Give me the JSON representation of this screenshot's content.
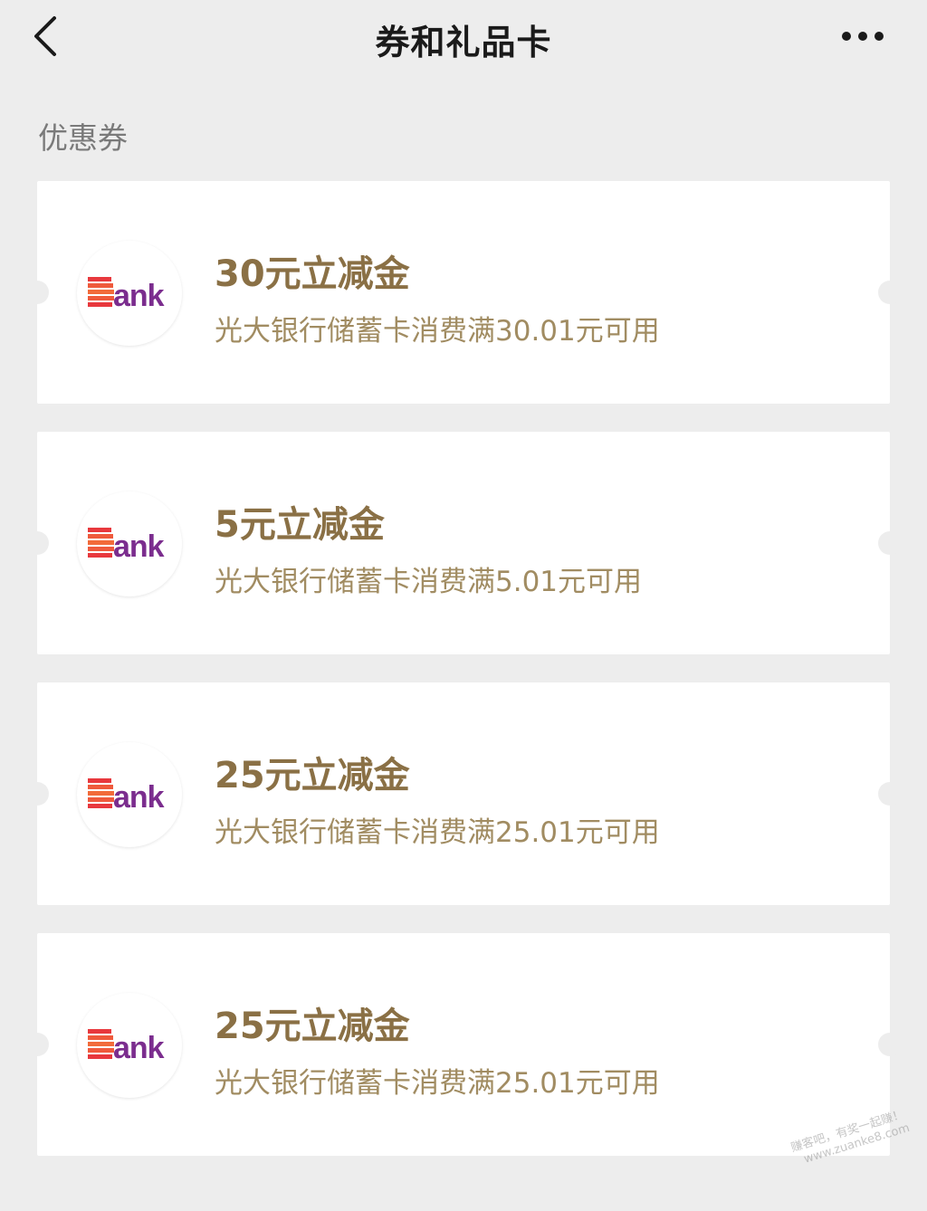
{
  "header": {
    "title": "券和礼品卡"
  },
  "section": {
    "label": "优惠券"
  },
  "coupons": [
    {
      "title": "30元立减金",
      "desc": "光大银行储蓄卡消费满30.01元可用",
      "logo_text": "Bank"
    },
    {
      "title": "5元立减金",
      "desc": "光大银行储蓄卡消费满5.01元可用",
      "logo_text": "Bank"
    },
    {
      "title": "25元立减金",
      "desc": "光大银行储蓄卡消费满25.01元可用",
      "logo_text": "Bank"
    },
    {
      "title": "25元立减金",
      "desc": "光大银行储蓄卡消费满25.01元可用",
      "logo_text": "Bank"
    }
  ],
  "watermark": {
    "line1": "赚客吧，有奖一起赚！",
    "line2": "www.zuanke8.com"
  },
  "colors": {
    "background": "#ededed",
    "card": "#ffffff",
    "title_gold": "#8a7045",
    "desc_gold": "#a18c62",
    "logo_red": "#e8383d",
    "logo_purple": "#7b2d8e"
  }
}
